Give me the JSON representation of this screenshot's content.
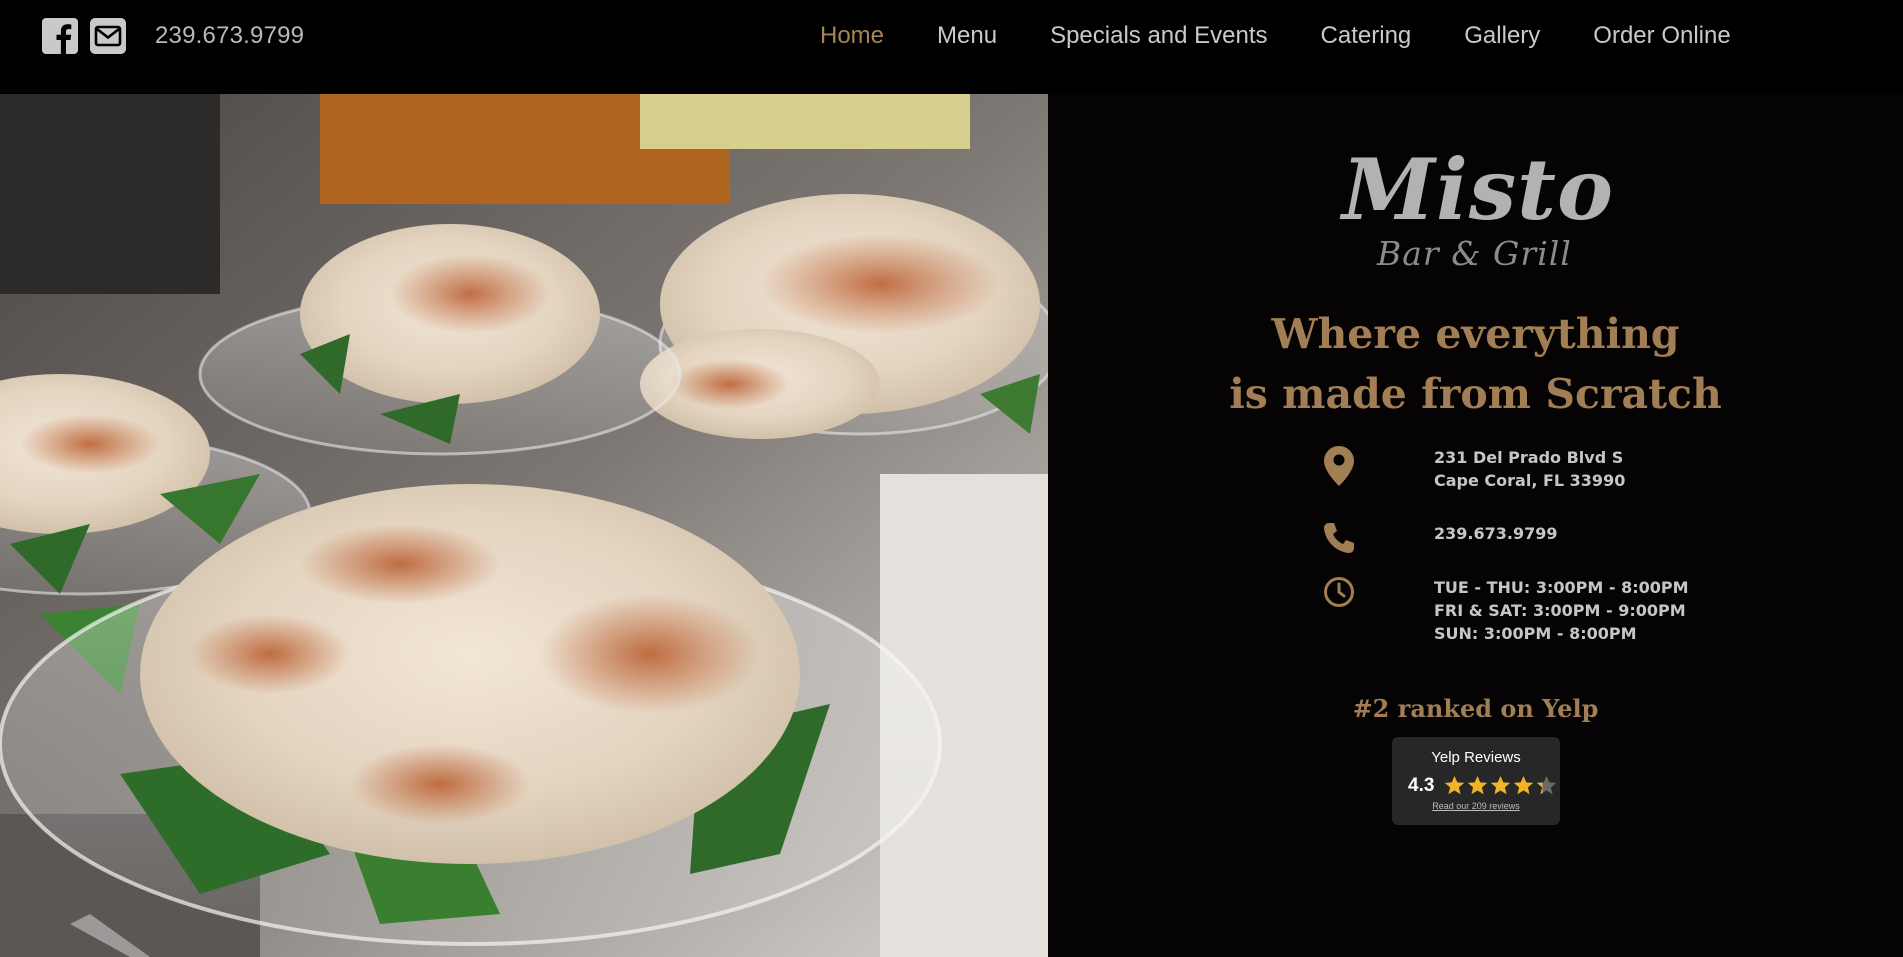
{
  "header": {
    "phone": "239.673.9799",
    "social": [
      {
        "icon": "facebook-icon"
      },
      {
        "icon": "email-icon"
      }
    ],
    "nav": [
      {
        "label": "Home",
        "active": true
      },
      {
        "label": "Menu",
        "active": false
      },
      {
        "label": "Specials and Events",
        "active": false
      },
      {
        "label": "Catering",
        "active": false
      },
      {
        "label": "Gallery",
        "active": false
      },
      {
        "label": "Order Online",
        "active": false
      }
    ]
  },
  "brand": {
    "name": "Misto",
    "subtitle": "Bar & Grill"
  },
  "tagline": {
    "line1": "Where everything",
    "line2": "is made from Scratch"
  },
  "contact": {
    "address_line1": "231 Del Prado Blvd S",
    "address_line2": "Cape Coral, FL 33990",
    "phone": "239.673.9799",
    "hours": [
      "TUE - THU: 3:00PM - 8:00PM",
      "FRI & SAT: 3:00PM - 9:00PM",
      "SUN: 3:00PM - 8:00PM"
    ],
    "icons": {
      "address": "map-pin-icon",
      "phone": "phone-icon",
      "hours": "clock-icon"
    }
  },
  "yelp": {
    "rank_text": "#2 ranked on Yelp",
    "widget_title": "Yelp Reviews",
    "rating": "4.3",
    "rating_value": 4.3,
    "max_rating": 5,
    "reviews_link": "Read our 209 reviews"
  },
  "colors": {
    "accent": "#a17e53",
    "background": "#050304",
    "star": "#f0b429"
  }
}
